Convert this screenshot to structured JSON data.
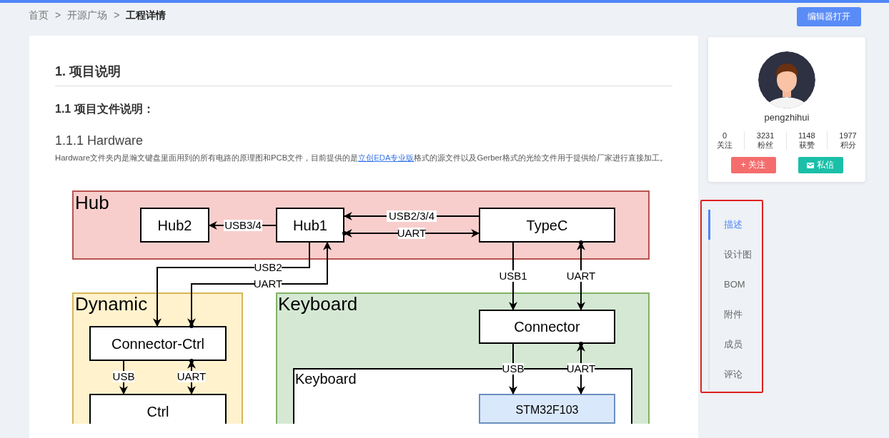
{
  "breadcrumb": [
    {
      "label": "首页",
      "current": false
    },
    {
      "label": "开源广场",
      "current": false
    },
    {
      "label": "工程详情",
      "current": true
    }
  ],
  "breadcrumb_separator": ">",
  "editor_button": "编辑器打开",
  "article": {
    "heading_1": "1. 项目说明",
    "heading_2": "1.1 项目文件说明：",
    "heading_3": "1.1.1 Hardware",
    "paragraph": {
      "before": "Hardware文件夹内是瀚文键盘里面用到的所有电路的原理图和PCB文件，目前提供的是",
      "link": "立创EDA专业版",
      "after": "格式的源文件以及Gerber格式的光绘文件用于提供给厂家进行直接加工。"
    },
    "diagram": {
      "groups": [
        {
          "label": "Hub",
          "color": "#f8cecc"
        },
        {
          "label": "Dynamic",
          "color": "#fff2cc"
        },
        {
          "label": "Keyboard",
          "color": "#d5e8d4"
        },
        {
          "label": "Keyboard",
          "color": "#ffffff"
        }
      ],
      "nodes": [
        {
          "label": "Hub2"
        },
        {
          "label": "Hub1"
        },
        {
          "label": "TypeC"
        },
        {
          "label": "Connector"
        },
        {
          "label": "Connector-Ctrl"
        },
        {
          "label": "Ctrl"
        },
        {
          "label": "STM32F103"
        }
      ],
      "edges": [
        {
          "label": "USB3/4",
          "bidirectional": false
        },
        {
          "label": "USB2/3/4",
          "bidirectional": false
        },
        {
          "label": "UART",
          "bidirectional": true
        },
        {
          "label": "USB2",
          "bidirectional": false
        },
        {
          "label": "UART",
          "bidirectional": true
        },
        {
          "label": "USB1",
          "bidirectional": false
        },
        {
          "label": "UART",
          "bidirectional": true
        },
        {
          "label": "USB",
          "bidirectional": false
        },
        {
          "label": "UART",
          "bidirectional": true
        },
        {
          "label": "USB",
          "bidirectional": false
        },
        {
          "label": "UART",
          "bidirectional": true
        }
      ]
    }
  },
  "profile": {
    "username": "pengzhihui",
    "stats": [
      {
        "value": "0",
        "label": "关注"
      },
      {
        "value": "3231",
        "label": "粉丝"
      },
      {
        "value": "1148",
        "label": "获赞"
      },
      {
        "value": "1977",
        "label": "积分"
      }
    ],
    "follow_button": "+ 关注",
    "message_button": "私信"
  },
  "nav": [
    {
      "label": "描述",
      "selected": true
    },
    {
      "label": "设计图",
      "selected": false
    },
    {
      "label": "BOM",
      "selected": false
    },
    {
      "label": "附件",
      "selected": false
    },
    {
      "label": "成员",
      "selected": false
    },
    {
      "label": "评论",
      "selected": false
    }
  ]
}
